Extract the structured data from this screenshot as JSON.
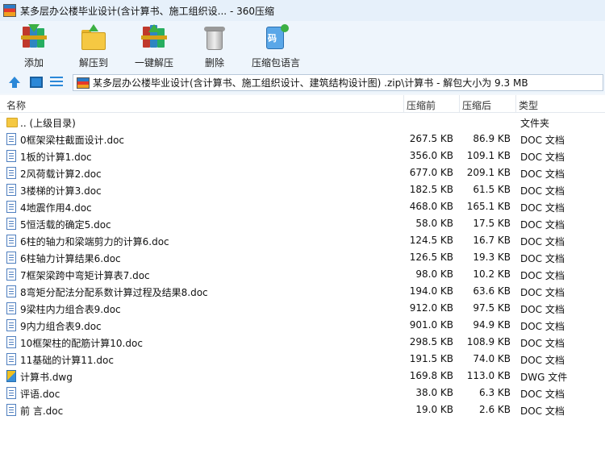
{
  "window": {
    "title": "某多层办公楼毕业设计(含计算书、施工组织设... - 360压缩"
  },
  "toolbar": {
    "add": "添加",
    "extract_to": "解压到",
    "one_click_extract": "一键解压",
    "delete": "删除",
    "compress_lang": "压缩包语言"
  },
  "address": {
    "path": "某多层办公楼毕业设计(含计算书、施工组织设计、建筑结构设计图) .zip\\计算书 - 解包大小为 9.3 MB"
  },
  "columns": {
    "name": "名称",
    "size": "压缩前",
    "packed": "压缩后",
    "type": "类型"
  },
  "files": [
    {
      "name": ".. (上级目录)",
      "size": "",
      "packed": "",
      "type": "文件夹",
      "icon": "folder-icon"
    },
    {
      "name": "0框架梁柱截面设计.doc",
      "size": "267.5 KB",
      "packed": "86.9 KB",
      "type": "DOC 文档",
      "icon": "doc-icon"
    },
    {
      "name": "1板的计算1.doc",
      "size": "356.0 KB",
      "packed": "109.1 KB",
      "type": "DOC 文档",
      "icon": "doc-icon"
    },
    {
      "name": "2风荷载计算2.doc",
      "size": "677.0 KB",
      "packed": "209.1 KB",
      "type": "DOC 文档",
      "icon": "doc-icon"
    },
    {
      "name": "3楼梯的计算3.doc",
      "size": "182.5 KB",
      "packed": "61.5 KB",
      "type": "DOC 文档",
      "icon": "doc-icon"
    },
    {
      "name": "4地震作用4.doc",
      "size": "468.0 KB",
      "packed": "165.1 KB",
      "type": "DOC 文档",
      "icon": "doc-icon"
    },
    {
      "name": "5恒活载的确定5.doc",
      "size": "58.0 KB",
      "packed": "17.5 KB",
      "type": "DOC 文档",
      "icon": "doc-icon"
    },
    {
      "name": "6柱的轴力和梁端剪力的计算6.doc",
      "size": "124.5 KB",
      "packed": "16.7 KB",
      "type": "DOC 文档",
      "icon": "doc-icon"
    },
    {
      "name": "6柱轴力计算结果6.doc",
      "size": "126.5 KB",
      "packed": "19.3 KB",
      "type": "DOC 文档",
      "icon": "doc-icon"
    },
    {
      "name": "7框架梁跨中弯矩计算表7.doc",
      "size": "98.0 KB",
      "packed": "10.2 KB",
      "type": "DOC 文档",
      "icon": "doc-icon"
    },
    {
      "name": "8弯矩分配法分配系数计算过程及结果8.doc",
      "size": "194.0 KB",
      "packed": "63.6 KB",
      "type": "DOC 文档",
      "icon": "doc-icon"
    },
    {
      "name": "9梁柱内力组合表9.doc",
      "size": "912.0 KB",
      "packed": "97.5 KB",
      "type": "DOC 文档",
      "icon": "doc-icon"
    },
    {
      "name": "9内力组合表9.doc",
      "size": "901.0 KB",
      "packed": "94.9 KB",
      "type": "DOC 文档",
      "icon": "doc-icon"
    },
    {
      "name": "10框架柱的配筋计算10.doc",
      "size": "298.5 KB",
      "packed": "108.9 KB",
      "type": "DOC 文档",
      "icon": "doc-icon"
    },
    {
      "name": "11基础的计算11.doc",
      "size": "191.5 KB",
      "packed": "74.0 KB",
      "type": "DOC 文档",
      "icon": "doc-icon"
    },
    {
      "name": "计算书.dwg",
      "size": "169.8 KB",
      "packed": "113.0 KB",
      "type": "DWG 文件",
      "icon": "dwg-icon"
    },
    {
      "name": "评语.doc",
      "size": "38.0 KB",
      "packed": "6.3 KB",
      "type": "DOC 文档",
      "icon": "doc-icon"
    },
    {
      "name": "前  言.doc",
      "size": "19.0 KB",
      "packed": "2.6 KB",
      "type": "DOC 文档",
      "icon": "doc-icon"
    }
  ]
}
